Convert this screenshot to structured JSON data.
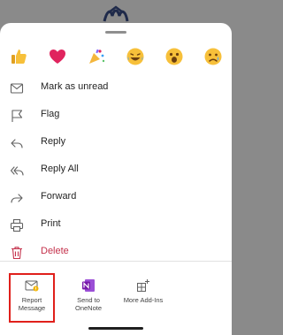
{
  "reactions": [
    {
      "name": "thumbs-up",
      "icon": "thumbs-up-icon"
    },
    {
      "name": "heart",
      "icon": "heart-icon"
    },
    {
      "name": "celebrate",
      "icon": "party-popper-icon"
    },
    {
      "name": "laugh",
      "icon": "laughing-face-icon"
    },
    {
      "name": "surprised",
      "icon": "surprised-face-icon"
    },
    {
      "name": "sad",
      "icon": "sad-face-icon"
    }
  ],
  "menu": {
    "items": [
      {
        "label": "Mark as unread",
        "icon": "envelope-icon"
      },
      {
        "label": "Flag",
        "icon": "flag-icon"
      },
      {
        "label": "Reply",
        "icon": "reply-icon"
      },
      {
        "label": "Reply All",
        "icon": "reply-all-icon"
      },
      {
        "label": "Forward",
        "icon": "forward-icon"
      },
      {
        "label": "Print",
        "icon": "printer-icon"
      },
      {
        "label": "Delete",
        "icon": "trash-icon"
      }
    ]
  },
  "addins": [
    {
      "label": "Report\nMessage",
      "icon": "report-message-icon"
    },
    {
      "label": "Send to\nOneNote",
      "icon": "onenote-icon"
    },
    {
      "label": "More Add-Ins",
      "icon": "add-ins-icon"
    }
  ],
  "colors": {
    "danger": "#c4314b",
    "highlight": "#e0201b",
    "onenote": "#7719aa"
  }
}
